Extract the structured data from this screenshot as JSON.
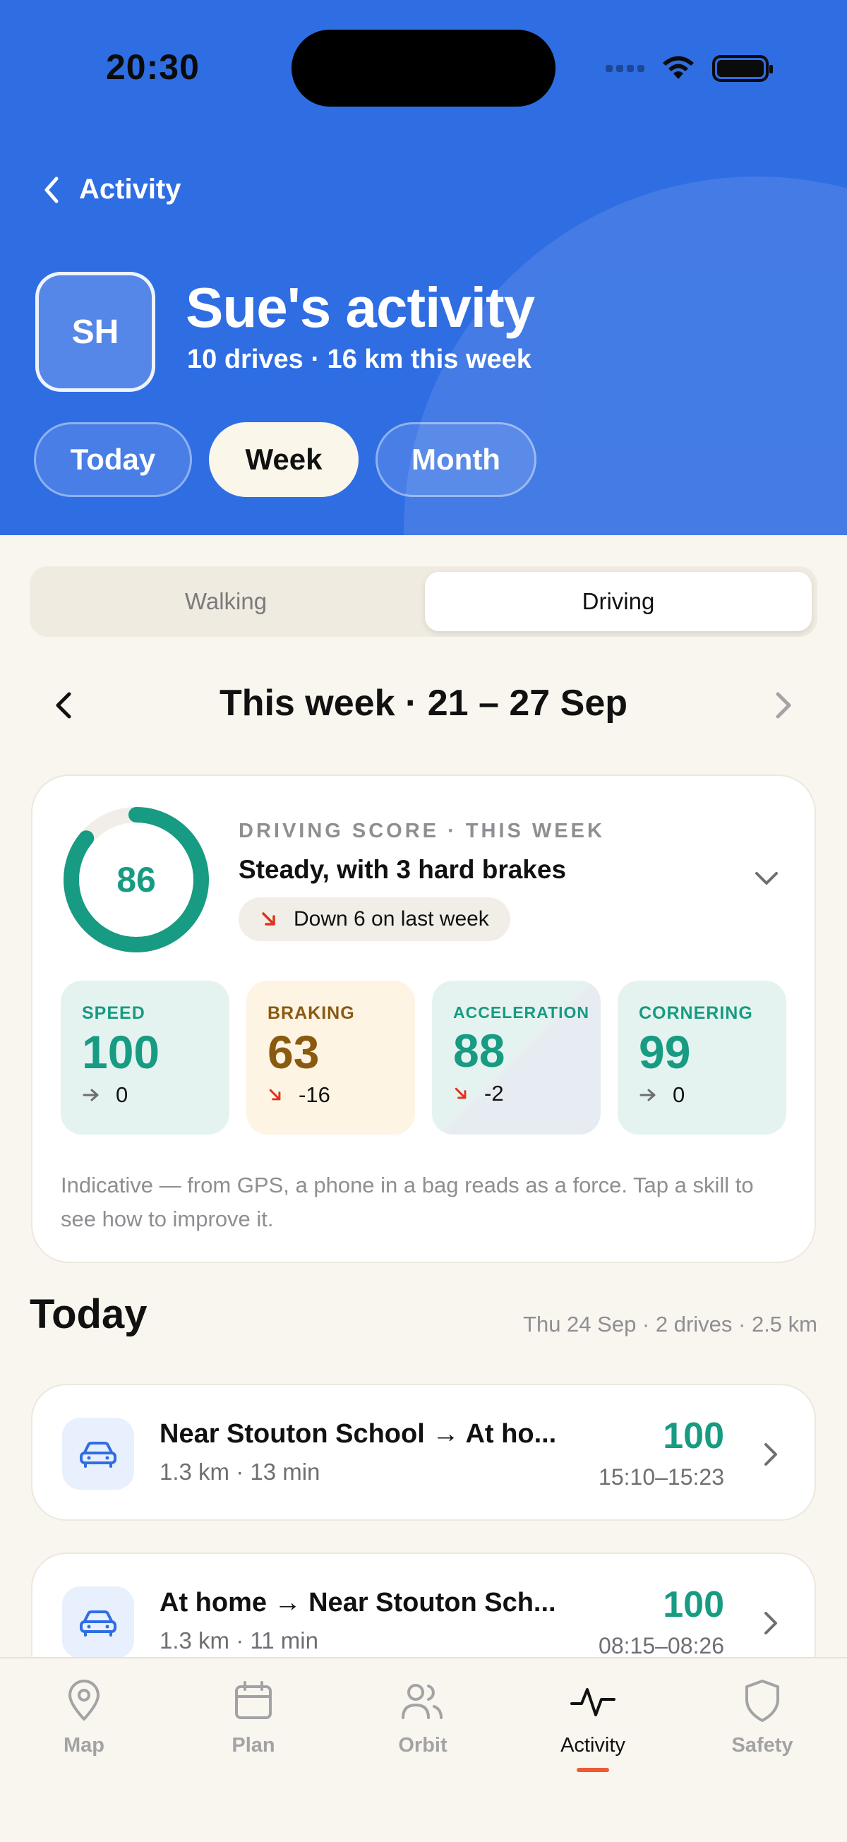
{
  "status_bar": {
    "time": "20:30"
  },
  "header": {
    "back_label": "Activity",
    "avatar_initials": "SH",
    "title": "Sue's activity",
    "subtitle": "10 drives · 16 km this week",
    "range_tabs": [
      {
        "label": "Today",
        "active": false
      },
      {
        "label": "Week",
        "active": true
      },
      {
        "label": "Month",
        "active": false
      }
    ]
  },
  "mode_toggle": {
    "options": [
      {
        "label": "Walking",
        "active": false
      },
      {
        "label": "Driving",
        "active": true
      }
    ]
  },
  "week_nav": {
    "title": "This week · 21 – 27 Sep"
  },
  "score_card": {
    "score": "86",
    "score_fraction": 0.86,
    "kicker": "DRIVING SCORE · THIS WEEK",
    "headline": "Steady, with 3 hard brakes",
    "trend": "Down 6 on last week",
    "skills": [
      {
        "name": "SPEED",
        "value": "100",
        "delta": "0",
        "trend": "flat"
      },
      {
        "name": "BRAKING",
        "value": "63",
        "delta": "-16",
        "trend": "down"
      },
      {
        "name": "ACCELERATION",
        "value": "88",
        "delta": "-2",
        "trend": "down"
      },
      {
        "name": "CORNERING",
        "value": "99",
        "delta": "0",
        "trend": "flat"
      }
    ],
    "note": "Indicative — from GPS, a phone in a bag reads as a force. Tap a skill to see how to improve it."
  },
  "today": {
    "title": "Today",
    "meta": "Thu 24 Sep · 2 drives · 2.5 km",
    "drives": [
      {
        "route": "Near Stouton School → At ho...",
        "meta": "1.3 km · 13 min",
        "score": "100",
        "time": "15:10–15:23"
      },
      {
        "route": "At home → Near Stouton Sch...",
        "meta": "1.3 km · 11 min",
        "score": "100",
        "time": "08:15–08:26"
      }
    ]
  },
  "bottom_nav": {
    "items": [
      {
        "label": "Map",
        "icon": "map-pin-icon",
        "active": false
      },
      {
        "label": "Plan",
        "icon": "calendar-icon",
        "active": false
      },
      {
        "label": "Orbit",
        "icon": "people-icon",
        "active": false
      },
      {
        "label": "Activity",
        "icon": "activity-icon",
        "active": true
      },
      {
        "label": "Safety",
        "icon": "shield-icon",
        "active": false
      }
    ]
  },
  "colors": {
    "header_blue": "#2f6de3",
    "score_green": "#179b82",
    "braking_brown": "#8a5a10",
    "trend_down_red": "#e0321e",
    "nav_active_underline": "#ef5a35"
  }
}
